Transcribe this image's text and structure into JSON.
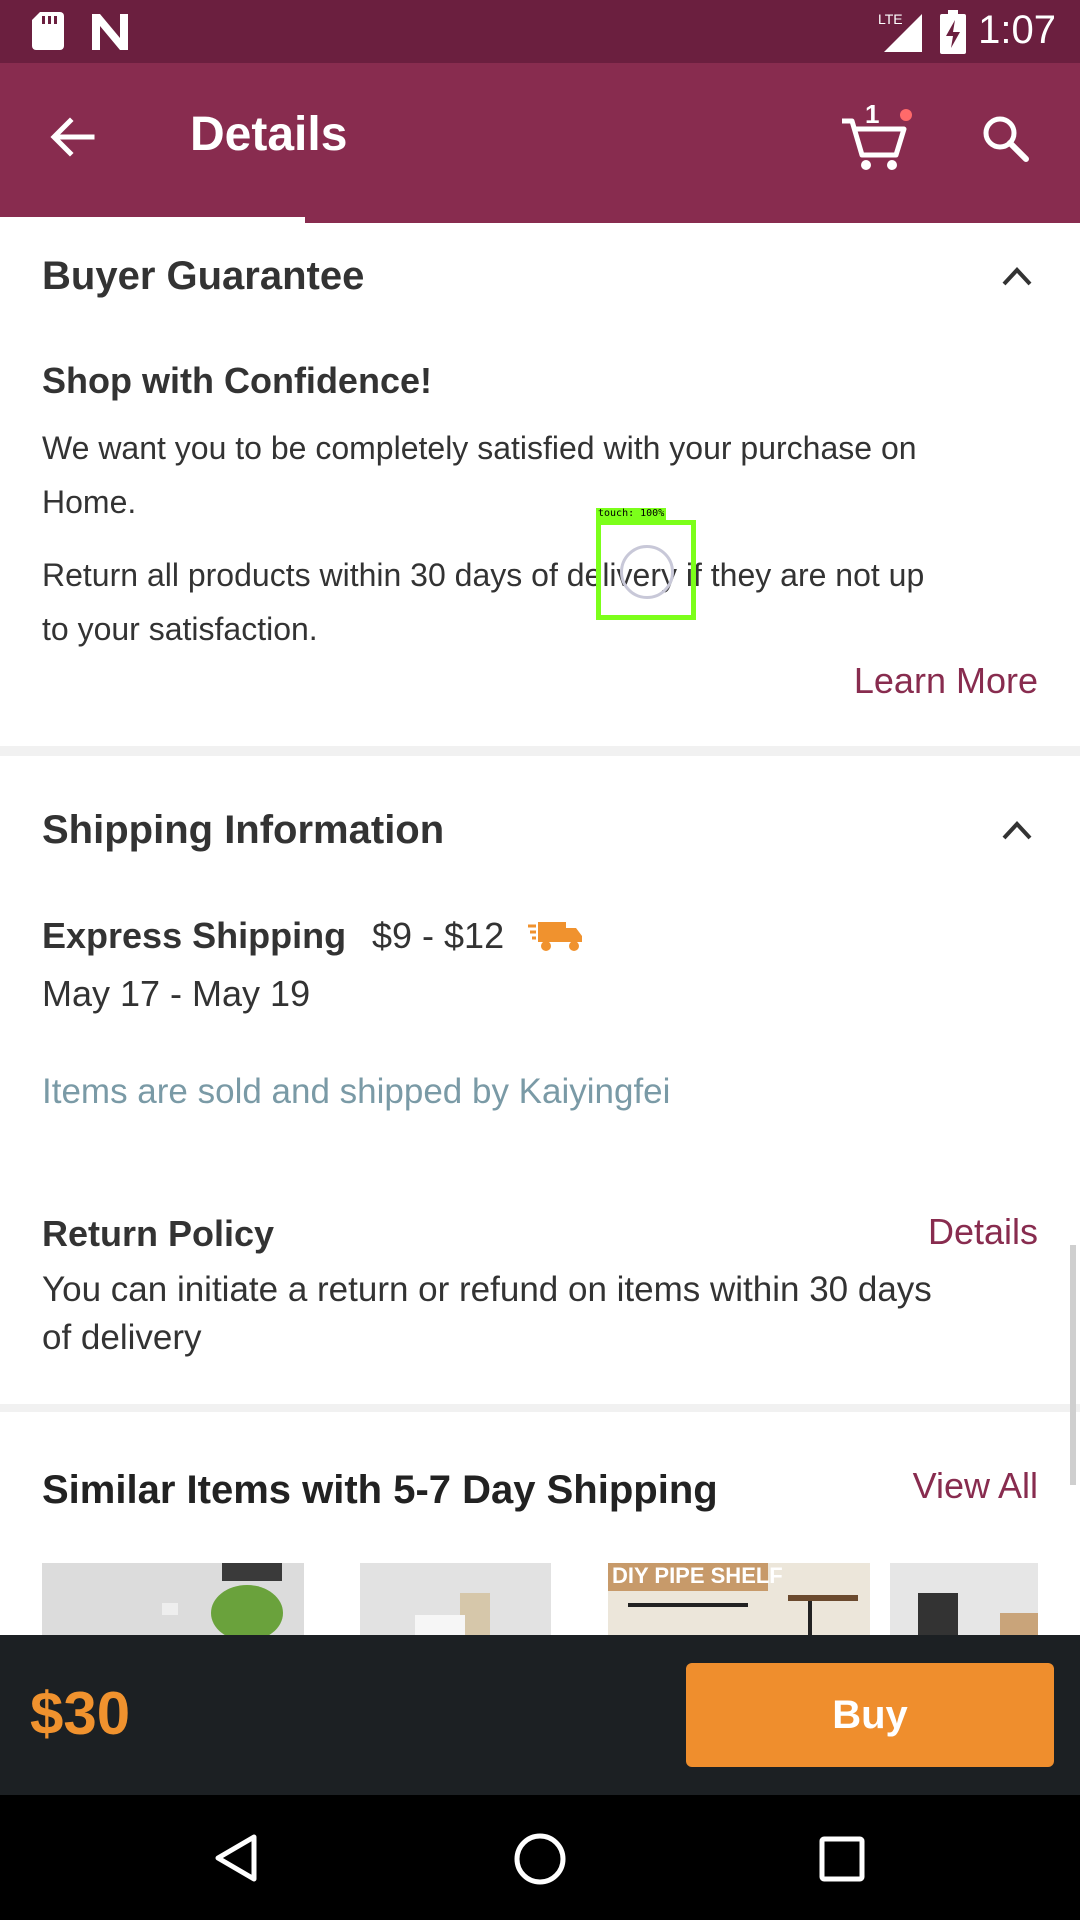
{
  "status_bar": {
    "time": "1:07",
    "network": "LTE"
  },
  "app_bar": {
    "title": "Details",
    "cart_count": "1"
  },
  "buyer_guarantee": {
    "title": "Buyer Guarantee",
    "subtitle": "Shop with Confidence!",
    "para1_line1": "We want you to be completely satisfied with your purchase on",
    "para1_line2": "Home.",
    "para2_line1": "Return all products within 30 days of delivery if they are not up",
    "para2_line2": "to your satisfaction.",
    "learn_more": "Learn More"
  },
  "shipping": {
    "title": "Shipping Information",
    "method": "Express Shipping",
    "price_range": "$9 - $12",
    "dates": "May 17 - May 19",
    "seller_note": "Items are sold and shipped by Kaiyingfei"
  },
  "return_policy": {
    "title": "Return Policy",
    "details_link": "Details",
    "line1": "You can initiate a return or refund on items within 30 days",
    "line2": "of delivery"
  },
  "similar": {
    "title": "Similar Items with 5-7 Day Shipping",
    "view_all": "View All",
    "thumb3_banner": "DIY PIPE SHELF"
  },
  "buy_bar": {
    "price": "$30",
    "buy_label": "Buy"
  },
  "touch_overlay": {
    "label": "touch: 100%"
  },
  "colors": {
    "brand": "#882c4f",
    "accent": "#ef8e2d",
    "muted_link": "#7a9aa6"
  }
}
